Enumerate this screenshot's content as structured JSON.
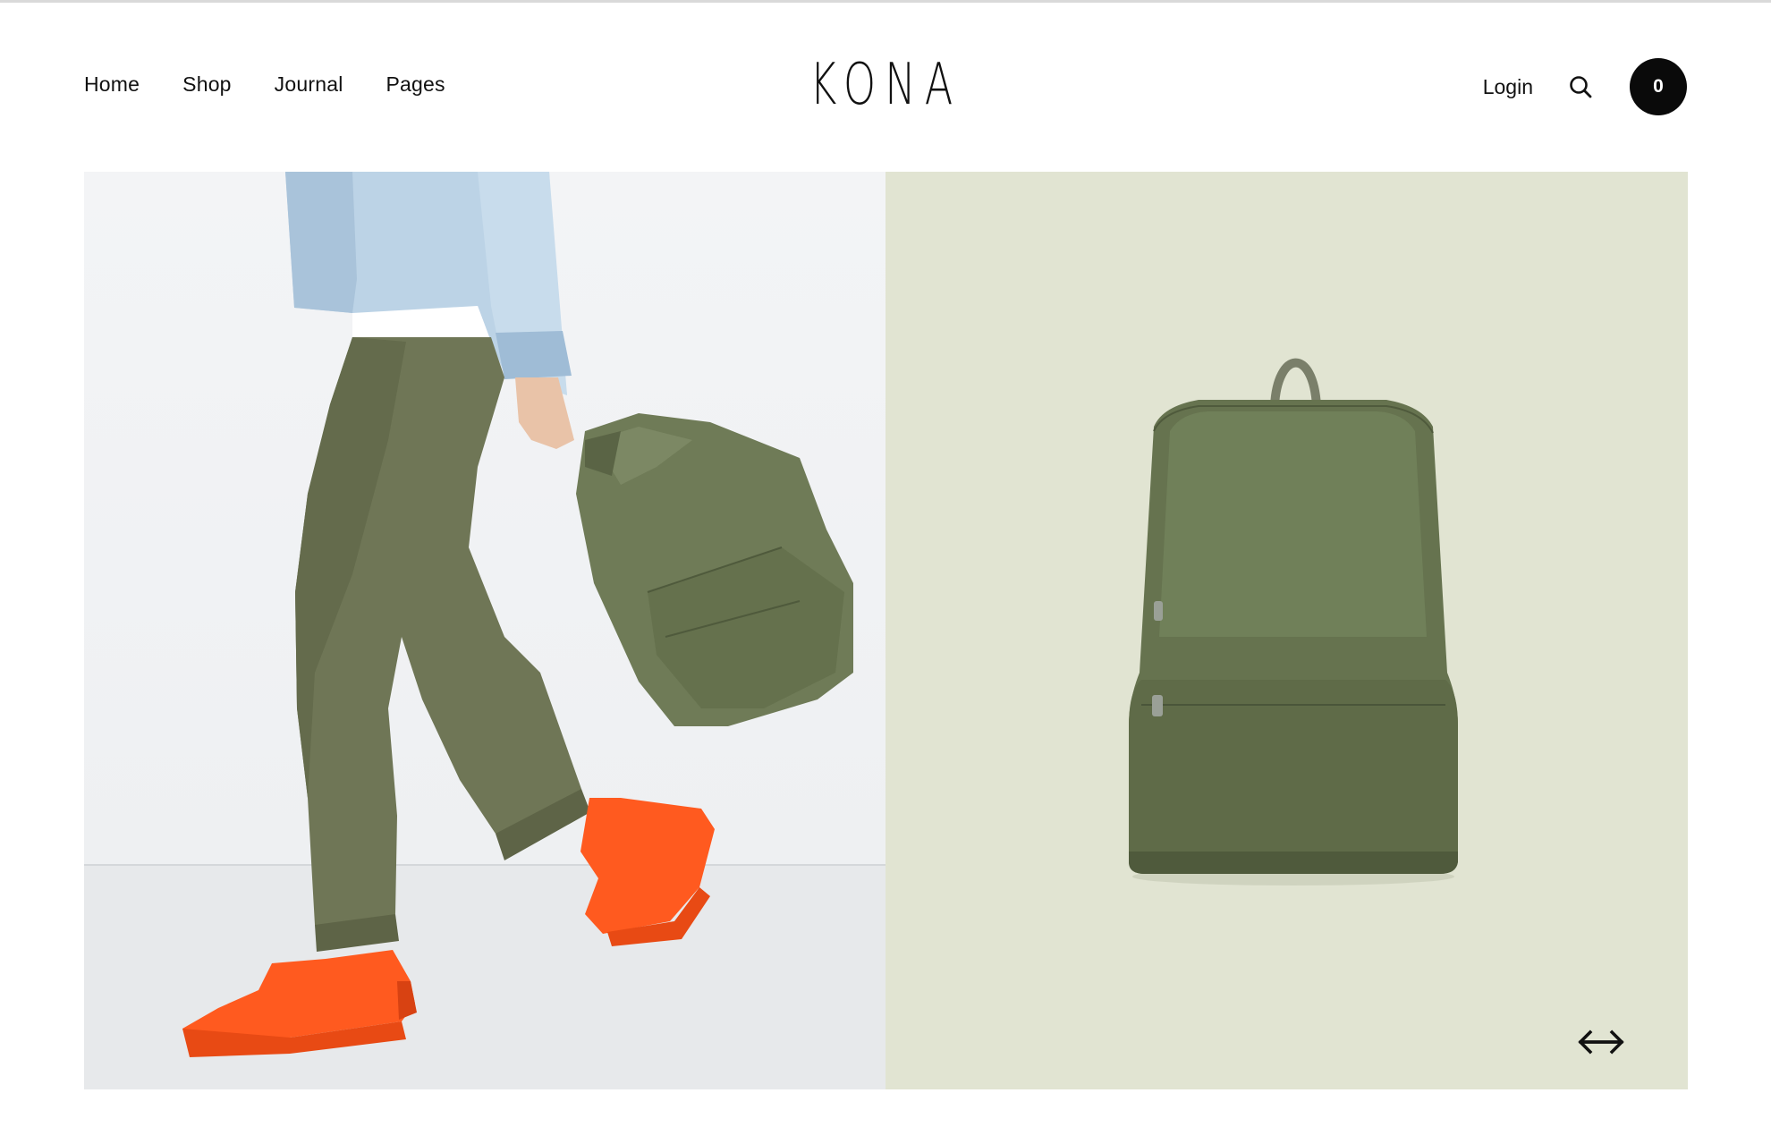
{
  "nav": {
    "items": [
      {
        "label": "Home"
      },
      {
        "label": "Shop"
      },
      {
        "label": "Journal"
      },
      {
        "label": "Pages"
      }
    ]
  },
  "brand": {
    "logo_text": "KONA"
  },
  "header": {
    "login_label": "Login",
    "cart_count": "0",
    "search_icon": "search-icon"
  },
  "hero": {
    "left_image": "model-walking-with-green-backpack",
    "right_image": "green-backpack-product",
    "prev_icon": "arrow-left-icon",
    "next_icon": "arrow-right-icon"
  },
  "colors": {
    "accent": "#0a0a0a",
    "panel_right_bg": "#e1e4d2",
    "panel_left_bg": "#f0f1f3",
    "bag_green": "#66734f",
    "sneaker_orange": "#ff5a1f",
    "pants_olive": "#6f7656",
    "denim": "#b9d0e4"
  }
}
